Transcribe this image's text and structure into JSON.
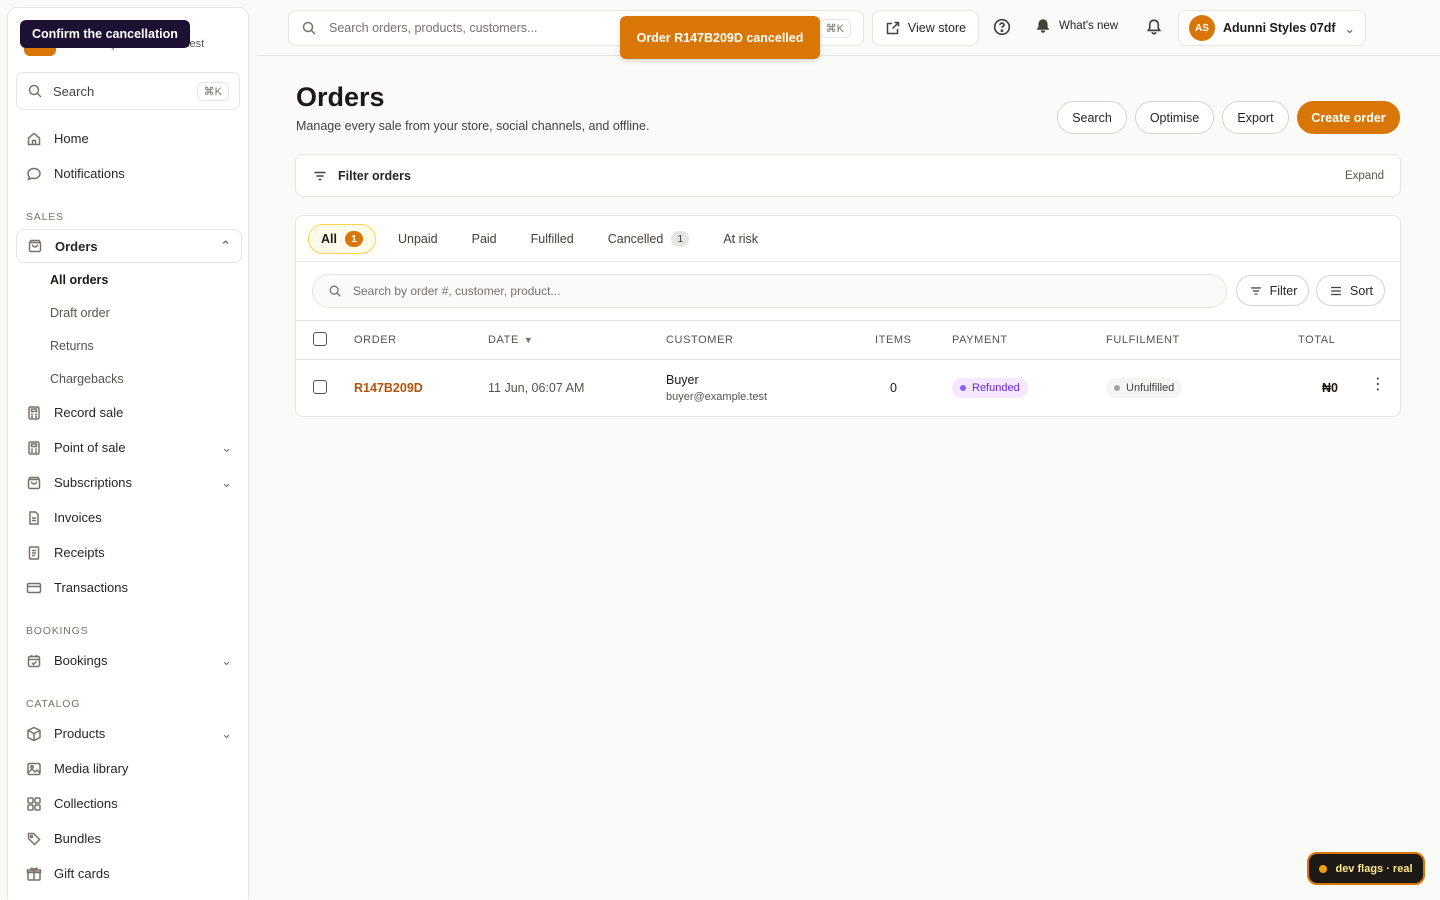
{
  "tooltip": "Confirm the cancellation",
  "sidebar": {
    "store_domain": "adunni-styles-07df.crate.test",
    "search_label": "Search",
    "search_kbd": "⌘K",
    "top_items": [
      {
        "label": "Home",
        "icon": "home-icon"
      },
      {
        "label": "Notifications",
        "icon": "chat-bubble-icon"
      }
    ],
    "sections": {
      "sales": "SALES",
      "bookings": "BOOKINGS",
      "catalog": "CATALOG"
    },
    "orders": {
      "label": "Orders",
      "sub": [
        "All orders",
        "Draft order",
        "Returns",
        "Chargebacks"
      ]
    },
    "sales_items": [
      {
        "label": "Record sale"
      },
      {
        "label": "Point of sale"
      },
      {
        "label": "Subscriptions"
      },
      {
        "label": "Invoices"
      },
      {
        "label": "Receipts"
      },
      {
        "label": "Transactions"
      }
    ],
    "bookings_items": [
      {
        "label": "Bookings"
      }
    ],
    "catalog_items": [
      {
        "label": "Products"
      },
      {
        "label": "Media library"
      },
      {
        "label": "Collections"
      },
      {
        "label": "Bundles"
      },
      {
        "label": "Gift cards"
      }
    ]
  },
  "topbar": {
    "search_placeholder": "Search orders, products, customers...",
    "search_kbd": "⌘K",
    "view_store": "View store",
    "whats_new": "What's new",
    "account_initials": "AS",
    "account_name": "Adunni Styles 07df"
  },
  "toast": "Order R147B209D cancelled",
  "page": {
    "title": "Orders",
    "subtitle": "Manage every sale from your store, social channels, and offline.",
    "actions": {
      "search": "Search",
      "optimise": "Optimise",
      "export": "Export",
      "create": "Create order"
    }
  },
  "filter_bar": {
    "label": "Filter orders",
    "expand": "Expand"
  },
  "tabs": [
    {
      "label": "All",
      "count": "1"
    },
    {
      "label": "Unpaid"
    },
    {
      "label": "Paid"
    },
    {
      "label": "Fulfilled"
    },
    {
      "label": "Cancelled",
      "count": "1"
    },
    {
      "label": "At risk"
    }
  ],
  "table": {
    "search_placeholder": "Search by order #, customer, product...",
    "filter": "Filter",
    "sort": "Sort",
    "headers": {
      "order": "ORDER",
      "date": "DATE",
      "customer": "CUSTOMER",
      "items": "ITEMS",
      "payment": "PAYMENT",
      "fulfilment": "FULFILMENT",
      "total": "TOTAL"
    },
    "rows": [
      {
        "order": "R147B209D",
        "date": "11 Jun, 06:07 AM",
        "customer_name": "Buyer",
        "customer_email": "buyer@example.test",
        "items": "0",
        "payment": "Refunded",
        "fulfilment": "Unfulfilled",
        "total": "₦0"
      }
    ]
  },
  "dev_flags": "dev flags · real",
  "colors": {
    "accent": "#d97706",
    "refunded": "#6d28d9",
    "tooltip": "#1c1033"
  }
}
